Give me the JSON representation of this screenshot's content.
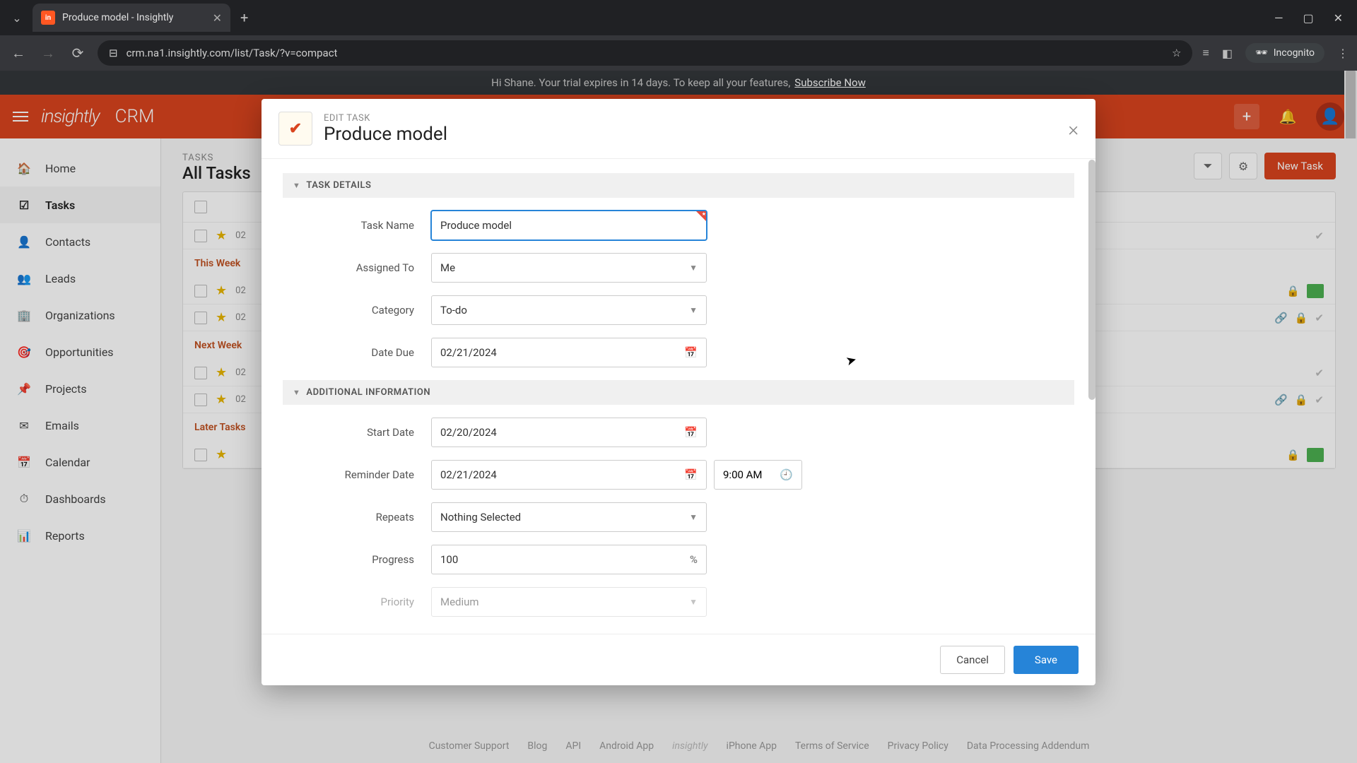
{
  "browser": {
    "tab_title": "Produce model - Insightly",
    "url": "crm.na1.insightly.com/list/Task/?v=compact",
    "incognito_label": "Incognito"
  },
  "banner": {
    "greeting": "Hi Shane. Your trial expires in 14 days. To keep all your features,",
    "cta": "Subscribe Now"
  },
  "header": {
    "logo": "insightly",
    "product": "CRM"
  },
  "sidebar": {
    "items": [
      {
        "label": "Home"
      },
      {
        "label": "Tasks"
      },
      {
        "label": "Contacts"
      },
      {
        "label": "Leads"
      },
      {
        "label": "Organizations"
      },
      {
        "label": "Opportunities"
      },
      {
        "label": "Projects"
      },
      {
        "label": "Emails"
      },
      {
        "label": "Calendar"
      },
      {
        "label": "Dashboards"
      },
      {
        "label": "Reports"
      }
    ]
  },
  "tasks_page": {
    "subtitle": "TASKS",
    "title": "All Tasks",
    "new_button": "New Task",
    "groups": [
      {
        "label": "This Week"
      },
      {
        "label": "Next Week"
      },
      {
        "label": "Later Tasks"
      }
    ],
    "row_date_prefix": "02"
  },
  "modal": {
    "edit_label": "EDIT TASK",
    "title": "Produce model",
    "sections": {
      "details": "TASK DETAILS",
      "additional": "ADDITIONAL INFORMATION"
    },
    "fields": {
      "task_name": {
        "label": "Task Name",
        "value": "Produce model"
      },
      "assigned_to": {
        "label": "Assigned To",
        "value": "Me"
      },
      "category": {
        "label": "Category",
        "value": "To-do"
      },
      "date_due": {
        "label": "Date Due",
        "value": "02/21/2024"
      },
      "start_date": {
        "label": "Start Date",
        "value": "02/20/2024"
      },
      "reminder_date": {
        "label": "Reminder Date",
        "value": "02/21/2024",
        "time": "9:00 AM"
      },
      "repeats": {
        "label": "Repeats",
        "value": "Nothing Selected"
      },
      "progress": {
        "label": "Progress",
        "value": "100"
      },
      "priority": {
        "label": "Priority",
        "value": "Medium"
      }
    },
    "buttons": {
      "cancel": "Cancel",
      "save": "Save"
    }
  },
  "footer": {
    "links": [
      "Customer Support",
      "Blog",
      "API",
      "Android App",
      "iPhone App",
      "Terms of Service",
      "Privacy Policy",
      "Data Processing Addendum"
    ]
  }
}
